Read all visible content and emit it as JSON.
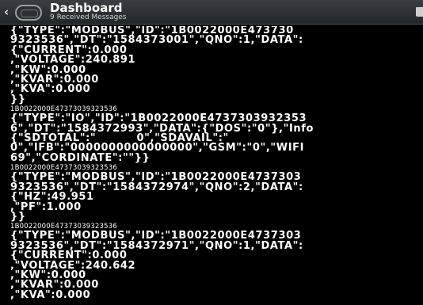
{
  "header": {
    "back_glyph": "‹",
    "title": "Dashboard",
    "subtitle": "9 Received Messages"
  },
  "messages": [
    {
      "lines": [
        "{\"TYPE\":\"MODBUS\",\"ID\":\"1B0022000E473730",
        "9323536\",\"DT\":\"1584373001\",\"QNO\":1,\"DATA\":",
        "{\"CURRENT\":0.000",
        ",\"VOLTAGE\":240.891",
        ",\"KW\":0.000",
        ",\"KVAR\":0.000",
        ",\"KVA\":0.000",
        "}}"
      ],
      "sender": "1B0022000E47373039323536"
    },
    {
      "lines": [
        "{\"TYPE\":\"IO\",\"ID\":\"1B0022000E4737303932353",
        "6\",\"DT\":\"1584372993\",\"DATA\":{\"DOS\":\"0\"},\"Info",
        "{\"SDTOTAL\":\"          0\",\"SDAVAIL\":\"",
        "0\",\"IFB\":\"0000000000000000\",\"GSM\":\"0\",\"WIFI",
        "69\",\"CORDINATE\":\"\"}}"
      ],
      "sender": "1B0022000E47373039323536"
    },
    {
      "lines": [
        "{\"TYPE\":\"MODBUS\",\"ID\":\"1B0022000E4737303",
        "9323536\",\"DT\":\"1584372974\",\"QNO\":2,\"DATA\":",
        "{\"HZ\":49.951",
        ",\"PF\":1.000",
        "}}"
      ],
      "sender": "1B0022000E47373039323536"
    },
    {
      "lines": [
        "{\"TYPE\":\"MODBUS\",\"ID\":\"1B0022000E4737303",
        "9323536\",\"DT\":\"1584372971\",\"QNO\":1,\"DATA\":",
        "{\"CURRENT\":0.000",
        ",\"VOLTAGE\":240.642",
        ",\"KW\":0.000",
        ",\"KVAR\":0.000",
        ",\"KVA\":0.000"
      ],
      "sender": ""
    }
  ]
}
